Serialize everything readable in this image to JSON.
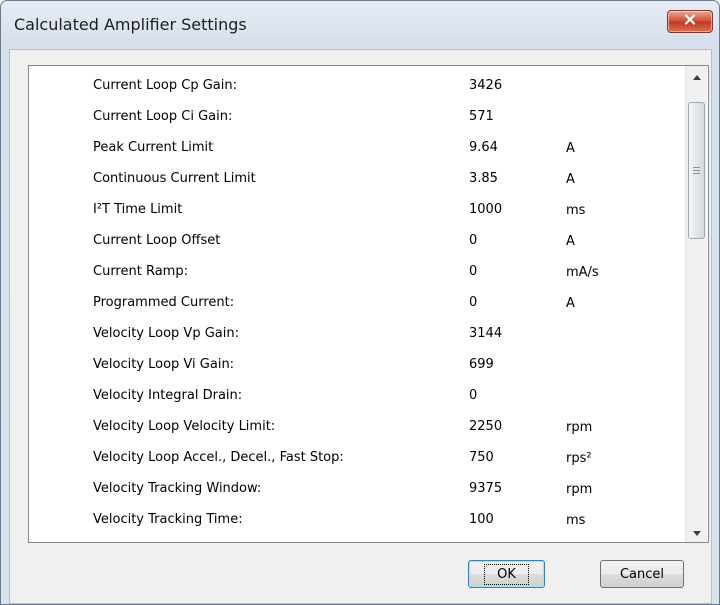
{
  "window": {
    "title": "Calculated Amplifier Settings"
  },
  "settings": {
    "rows": [
      {
        "label": "Current Loop Cp Gain:",
        "value": "3426",
        "unit": ""
      },
      {
        "label": "Current Loop Ci Gain:",
        "value": "571",
        "unit": ""
      },
      {
        "label": "Peak Current Limit",
        "value": "9.64",
        "unit": "A"
      },
      {
        "label": "Continuous Current Limit",
        "value": "3.85",
        "unit": "A"
      },
      {
        "label": "I²T Time Limit",
        "value": "1000",
        "unit": "ms"
      },
      {
        "label": "Current Loop Offset",
        "value": "0",
        "unit": "A"
      },
      {
        "label": "Current Ramp:",
        "value": "0",
        "unit": "mA/s"
      },
      {
        "label": "Programmed Current:",
        "value": "0",
        "unit": "A"
      },
      {
        "label": "Velocity Loop Vp Gain:",
        "value": "3144",
        "unit": ""
      },
      {
        "label": "Velocity Loop Vi Gain:",
        "value": "699",
        "unit": ""
      },
      {
        "label": "Velocity Integral Drain:",
        "value": "0",
        "unit": ""
      },
      {
        "label": "Velocity Loop Velocity Limit:",
        "value": "2250",
        "unit": "rpm"
      },
      {
        "label": "Velocity Loop Accel., Decel., Fast Stop:",
        "value": "750",
        "unit": "rps²"
      },
      {
        "label": "Velocity Tracking Window:",
        "value": "9375",
        "unit": "rpm"
      },
      {
        "label": "Velocity Tracking Time:",
        "value": "100",
        "unit": "ms"
      }
    ]
  },
  "buttons": {
    "ok_label": "OK",
    "cancel_label": "Cancel"
  },
  "icons": {
    "close": "close-icon",
    "scroll_up": "scroll-up-arrow-icon",
    "scroll_down": "scroll-down-arrow-icon",
    "thumb_grip": "scroll-grip-icon"
  },
  "colors": {
    "close_button": "#c94a34",
    "ok_focus_border": "#3c7fb1"
  }
}
